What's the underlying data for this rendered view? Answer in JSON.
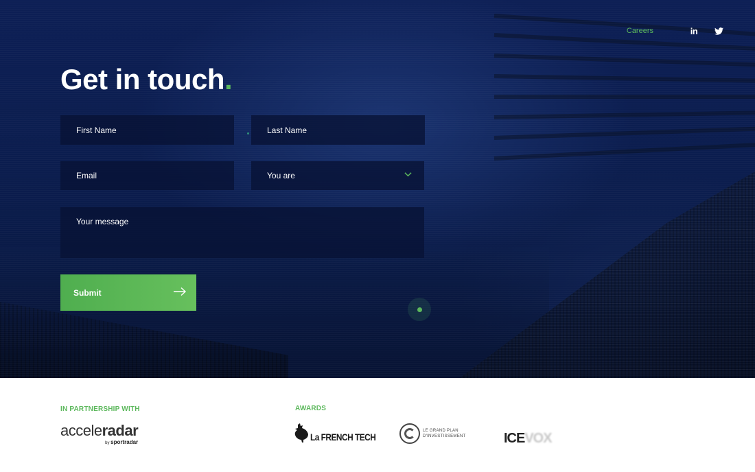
{
  "nav": {
    "careers": "Careers",
    "linkedin_icon": "linkedin-icon",
    "twitter_icon": "twitter-icon"
  },
  "hero": {
    "title": "Get in touch",
    "title_dot": "."
  },
  "form": {
    "first_name": "First Name",
    "last_name": "Last Name",
    "email": "Email",
    "you_are": "You are",
    "message": "Your message",
    "submit": "Submit"
  },
  "footer": {
    "partnership_label": "IN PARTNERSHIP WITH",
    "awards_label": "AWARDS",
    "partner": {
      "name_light": "accele",
      "name_bold": "radar",
      "by": "by",
      "parent": "sportradar"
    },
    "awards": {
      "french_tech": "La FRENCH TECH",
      "grand_plan": [
        "LE GRAND PLAN",
        "D'INVESTISSEMENT"
      ],
      "ice": "ICE",
      "vox": "VOX"
    }
  },
  "colors": {
    "accent": "#5cb85c",
    "hero_bg": "#0b1d4e",
    "field_bg": "#081234"
  }
}
